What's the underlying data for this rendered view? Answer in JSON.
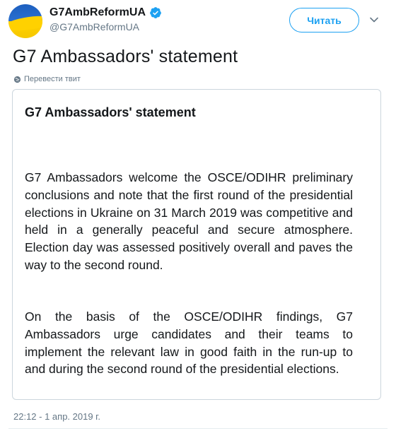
{
  "author": {
    "display_name": "G7AmbReformUA",
    "handle": "@G7AmbReformUA",
    "verified": true,
    "avatar": "ukrainian-flag"
  },
  "follow_button": {
    "label": "Читать"
  },
  "tweet": {
    "text": "G7 Ambassadors' statement",
    "translate_label": "Перевести твит",
    "timestamp": "22:12 - 1 апр. 2019 г."
  },
  "statement": {
    "title": "G7 Ambassadors' statement",
    "paragraphs": [
      "G7 Ambassadors welcome the OSCE/ODIHR preliminary conclusions and note that the first round of the presidential elections in Ukraine on 31 March 2019 was competitive and held in a generally peaceful and secure atmosphere. Election day was assessed positively overall and paves the way to the second round.",
      "On the basis of the OSCE/ODIHR findings, G7 Ambassadors urge candidates and their teams to implement the relevant law in good faith in the run-up to and during the second round of the presidential elections."
    ]
  },
  "colors": {
    "accent": "#1da1f2",
    "secondary_text": "#657786",
    "border": "#ccd6dd",
    "flag_blue": "#1d5fbf",
    "flag_yellow": "#ffd100"
  }
}
